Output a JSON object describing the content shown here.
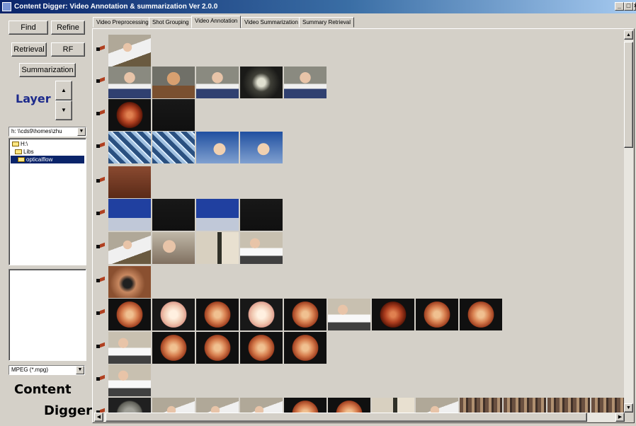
{
  "window": {
    "title": "Content Digger: Video Annotation & summarization Ver 2.0.0"
  },
  "left_panel": {
    "find_label": "Find",
    "refine_label": "Refine",
    "retrieval_label": "Retrieval",
    "rf_label": "RF",
    "summarization_label": "Summarization",
    "layer_label": "Layer",
    "spin_up": "▲",
    "spin_down": "▼",
    "drive_value": "h: \\\\cds9\\homes\\zhu",
    "tree": [
      {
        "label": "H:\\",
        "selected": false
      },
      {
        "label": "Libs",
        "selected": false
      },
      {
        "label": "opticalflow",
        "selected": true
      }
    ],
    "file_type_value": "MPEG (*.mpg)",
    "brand_line1": "Content",
    "brand_line2": "Digger"
  },
  "tabs": [
    {
      "label": "Video Preprocessing",
      "active": false
    },
    {
      "label": "Shot Grouping",
      "active": false
    },
    {
      "label": "Video Annotation",
      "active": true
    },
    {
      "label": "Video Summarization",
      "active": false
    },
    {
      "label": "Summary Retrieval",
      "active": false
    }
  ],
  "colors": {
    "bg": "#d4d0c8",
    "layer_text": "#1c2a8c",
    "selection": "#0a246a"
  },
  "groups": [
    {
      "shots": [
        "lab-person"
      ]
    },
    {
      "shots": [
        "presenter",
        "woman",
        "presenter",
        "xray",
        "presenter"
      ]
    },
    {
      "shots": [
        "retina-dark",
        "black"
      ]
    },
    {
      "shots": [
        "cells",
        "cells",
        "hand-blue",
        "hand-blue"
      ]
    },
    {
      "shots": [
        "book"
      ]
    },
    {
      "shots": [
        "screen",
        "black",
        "screen",
        "black"
      ]
    },
    {
      "shots": [
        "lab-person",
        "eye-exam",
        "lab-equip",
        "presenter-lab"
      ]
    },
    {
      "shots": [
        "closeup"
      ]
    },
    {
      "shots": [
        "retina",
        "retina-pale",
        "retina",
        "retina-pale",
        "retina",
        "presenter-lab",
        "retina-dark",
        "retina",
        "retina"
      ]
    },
    {
      "shots": [
        "presenter-lab",
        "retina",
        "retina",
        "retina",
        "retina"
      ]
    },
    {
      "shots": [
        "presenter-lab"
      ]
    },
    {
      "shots": [
        "retina-gray",
        "lab-person",
        "lab-person",
        "lab-person",
        "retina",
        "retina",
        "lab-equip",
        "lab-person",
        "crowd",
        "crowd",
        "crowd",
        "crowd"
      ]
    }
  ]
}
